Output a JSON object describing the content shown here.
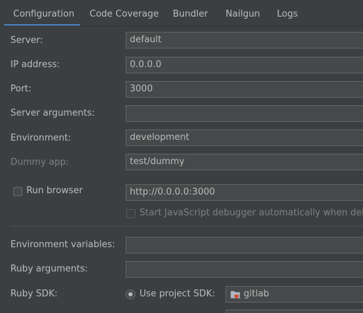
{
  "tabs": [
    "Configuration",
    "Code Coverage",
    "Bundler",
    "Nailgun",
    "Logs"
  ],
  "accent_color": "#4a88c7",
  "form": {
    "server": {
      "label": "Server:",
      "value": "default"
    },
    "ip": {
      "label": "IP address:",
      "value": "0.0.0.0"
    },
    "port": {
      "label": "Port:",
      "value": "3000"
    },
    "server_args": {
      "label": "Server arguments:",
      "value": ""
    },
    "environment": {
      "label": "Environment:",
      "value": "development"
    },
    "dummy_app": {
      "label": "Dummy app:",
      "value": "test/dummy"
    },
    "run_browser": {
      "label": "Run browser",
      "checked": false,
      "value": "http://0.0.0.0:3000"
    },
    "js_debugger": {
      "label": "Start JavaScript debugger automatically when debugging",
      "checked": false
    },
    "env_vars": {
      "label": "Environment variables:",
      "value": ""
    },
    "ruby_args": {
      "label": "Ruby arguments:",
      "value": ""
    },
    "ruby_sdk": {
      "label": "Ruby SDK:",
      "option_label": "Use project SDK:",
      "sdk_name": "gitlab",
      "sdk_icon": "ruby-folder-icon"
    }
  }
}
